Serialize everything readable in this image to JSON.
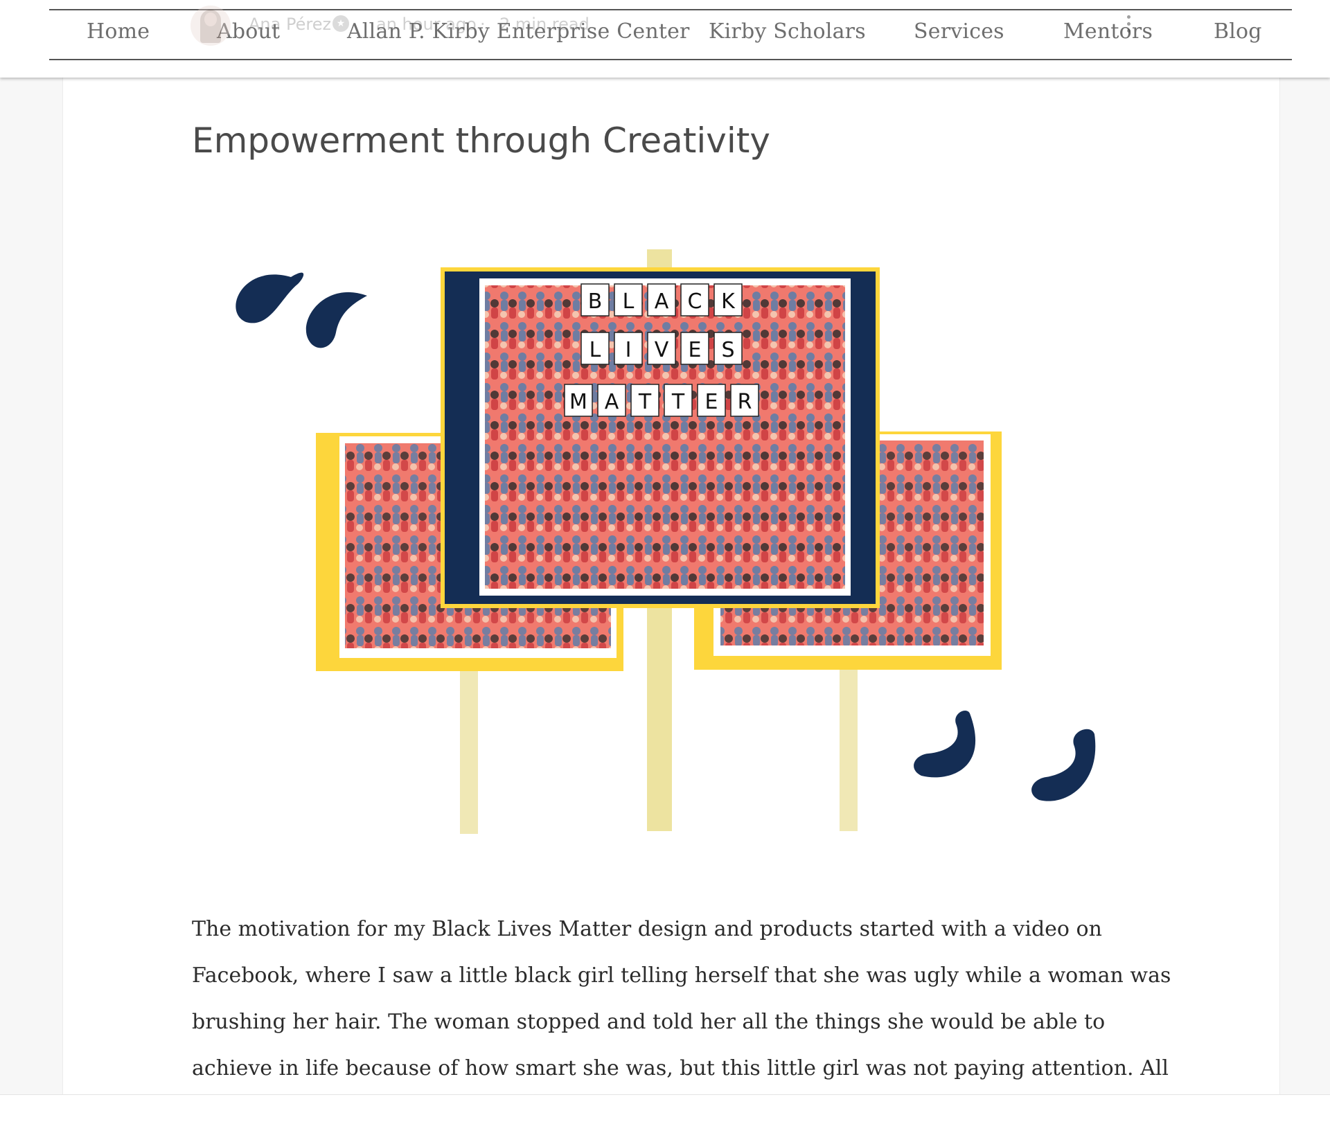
{
  "nav": {
    "items": [
      {
        "label": "Home"
      },
      {
        "label": "About"
      },
      {
        "label": "Allan P. Kirby Enterprise Center"
      },
      {
        "label": "Kirby Scholars"
      },
      {
        "label": "Services"
      },
      {
        "label": "Mentors"
      },
      {
        "label": "Blog"
      }
    ]
  },
  "post_meta": {
    "author": "Ana Pérez",
    "time": "an hour ago",
    "separator": "·",
    "read_time": "2 min read"
  },
  "post": {
    "title": "Empowerment through Creativity",
    "image": {
      "sign_text": [
        "BLACK",
        "LIVES",
        "MATTER"
      ],
      "colors": {
        "navy": "#142d54",
        "yellow": "#fdd63c",
        "pole": "#ede3a0",
        "coral": "#f07a6e"
      }
    },
    "body_lines": [
      "The motivation for my Black Lives Matter design and products started with a video on",
      "Facebook, where I saw a little black girl telling herself that she was ugly while a woman was",
      "brushing her hair. The woman stopped and told her all the things she would be able to",
      "achieve in life because of how smart she was, but this little girl was not paying attention. All"
    ]
  }
}
